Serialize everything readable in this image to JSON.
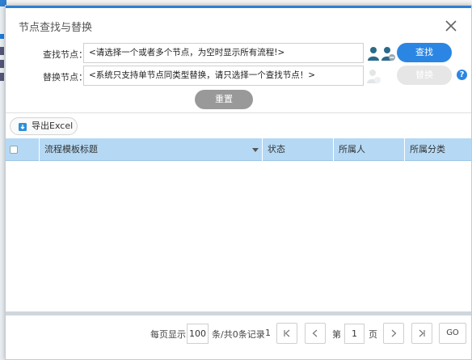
{
  "dialog": {
    "title": "节点查找与替换"
  },
  "find_row": {
    "label": "查找节点：",
    "value": "<请选择一个或者多个节点，为空时显示所有流程!>",
    "button_label": "查找"
  },
  "replace_row": {
    "label": "替换节点：",
    "value": "<系统只支持单节点同类型替换，请只选择一个查找节点！>",
    "button_label": "替换",
    "help_label": "?"
  },
  "reset_label": "重置",
  "export_label": "导出Excel",
  "grid": {
    "columns": [
      "流程模板标题",
      "状态",
      "所属人",
      "所属分类"
    ],
    "rows": []
  },
  "pager": {
    "per_page_label": "每页显示",
    "per_page_value": "100",
    "records_label": "条/共0条记录",
    "total_pages": "1",
    "page_prefix": "第",
    "page_value": "1",
    "page_suffix": "页",
    "go_label": "GO"
  },
  "colors": {
    "accent": "#2b86e3",
    "header_bg": "#b5d9f5",
    "reset_bg": "#999999"
  },
  "icons": {
    "close": "close-icon",
    "select_user": "user-select-icon",
    "select_users": "users-select-icon",
    "replace_user": "user-replace-icon",
    "help": "help-icon",
    "export": "excel-export-icon",
    "first": "first-page-icon",
    "prev": "prev-page-icon",
    "next": "next-page-icon",
    "last": "last-page-icon"
  }
}
